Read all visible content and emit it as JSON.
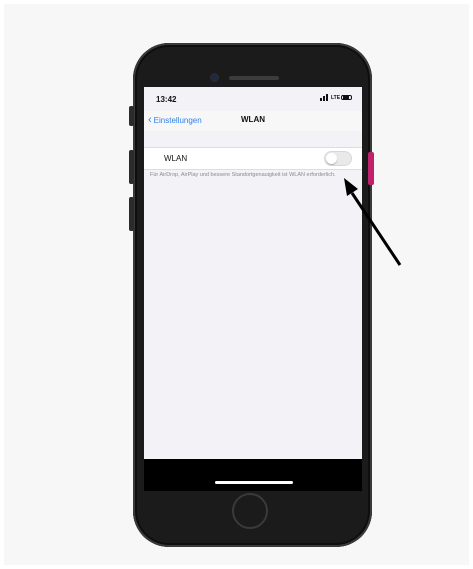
{
  "status_bar": {
    "time": "13:42",
    "network": "LTE"
  },
  "nav": {
    "back_label": "Einstellungen",
    "title": "WLAN"
  },
  "wlan_row": {
    "label": "WLAN",
    "toggle_on": false
  },
  "footer": {
    "text": "Für AirDrop, AirPlay und bessere Standortgenauigkeit ist WLAN erforderlich."
  },
  "colors": {
    "accent": "#2f80ed",
    "annotation_arrow": "#000000",
    "side_button": "#c1206a"
  }
}
